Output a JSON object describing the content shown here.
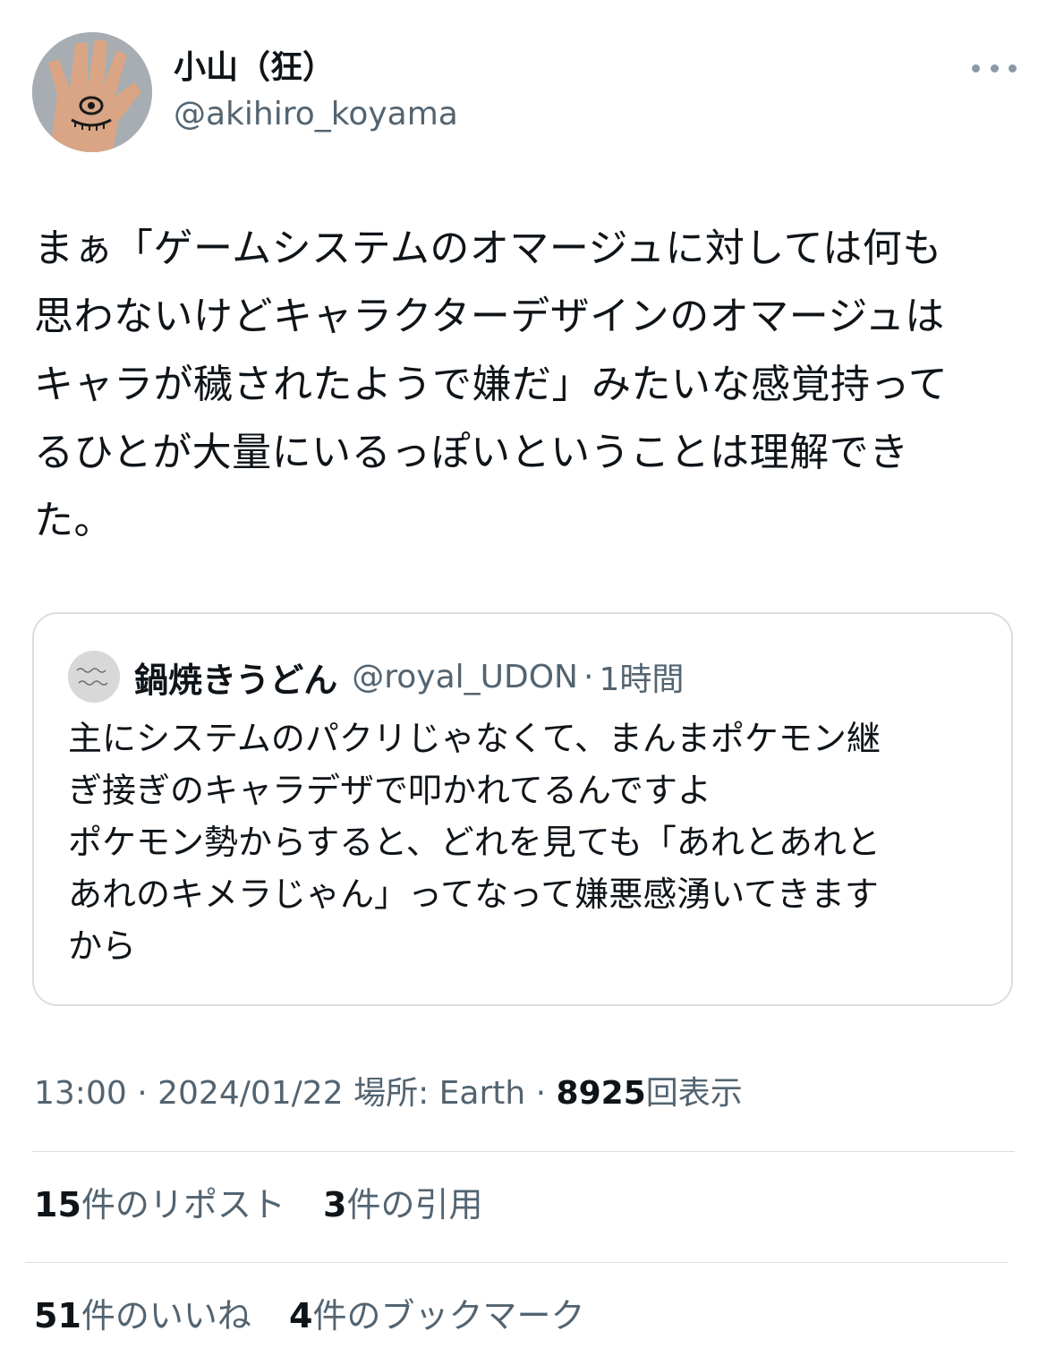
{
  "author": {
    "display_name": "小山（狂）",
    "handle": "@akihiro_koyama"
  },
  "tweet": {
    "text": "まぁ「ゲームシステムのオマージュに対しては何も\n思わないけどキャラクターデザインのオマージュは\nキャラが穢されたようで嫌だ」みたいな感覚持って\nるひとが大量にいるっぽいということは理解でき\nた。"
  },
  "quote": {
    "display_name": "鍋焼きうどん",
    "handle": "@royal_UDON",
    "separator": "·",
    "time": "1時間",
    "text": "主にシステムのパクリじゃなくて、まんまポケモン継\nぎ接ぎのキャラデザで叩かれてるんですよ\nポケモン勢からすると、どれを見ても「あれとあれと\nあれのキメラじゃん」ってなって嫌悪感湧いてきます\nから"
  },
  "meta": {
    "time": "13:00",
    "sep1": "·",
    "date": "2024/01/22",
    "location": "場所: Earth",
    "sep2": "·",
    "views": "8925",
    "views_label": "回表示"
  },
  "stats": {
    "reposts": "15",
    "reposts_label": "件のリポスト",
    "quotes": "3",
    "quotes_label": "件の引用",
    "likes": "51",
    "likes_label": "件のいいね",
    "bookmarks": "4",
    "bookmarks_label": "件のブックマーク"
  },
  "icons": {
    "more": "more-horizontal-icon"
  },
  "colors": {
    "primary_text": "#0f1419",
    "secondary_text": "#536471",
    "border": "#d9dee3"
  }
}
